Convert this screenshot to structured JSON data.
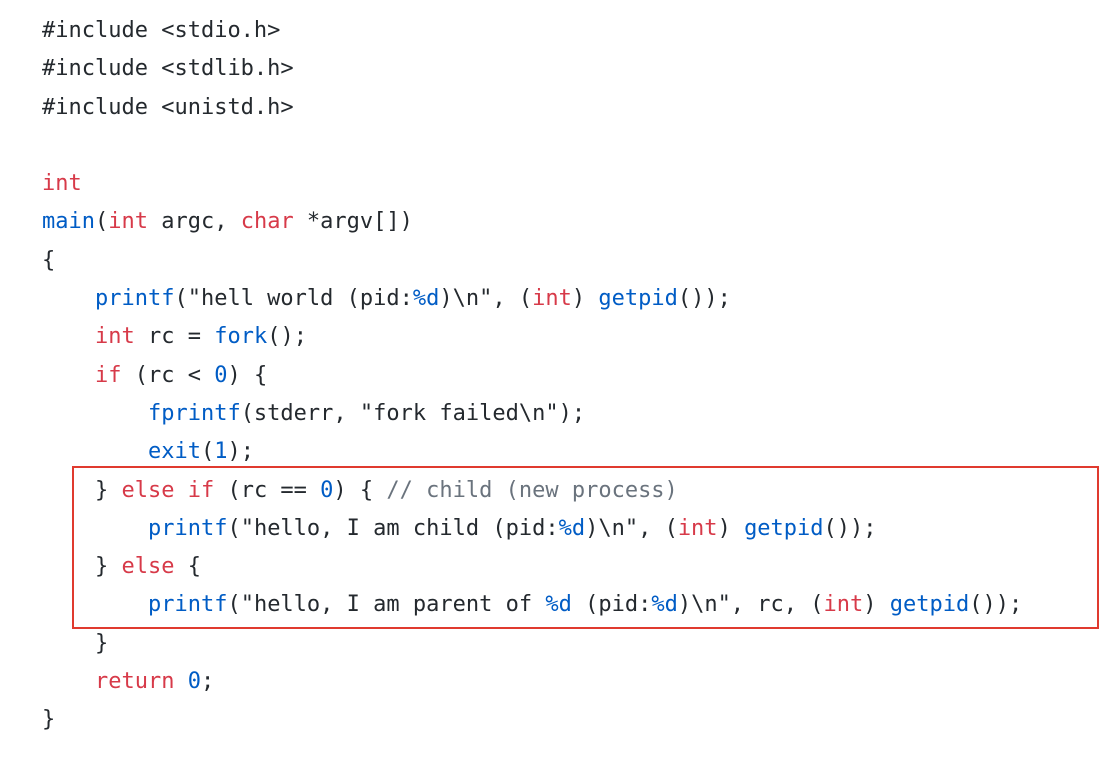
{
  "code": {
    "l1": {
      "a": "#include",
      "b": " <stdio.h>"
    },
    "l2": {
      "a": "#include",
      "b": " <stdlib.h>"
    },
    "l3": {
      "a": "#include",
      "b": " <unistd.h>"
    },
    "l5": {
      "a": "int"
    },
    "l6": {
      "a": "main",
      "b": "(",
      "c": "int",
      "d": " argc, ",
      "e": "char",
      "f": " *argv[])"
    },
    "l7": {
      "a": "{"
    },
    "l8": {
      "a": "printf",
      "b": "(\"hell world (pid:",
      "c": "%d",
      "d": ")\\n\", (",
      "e": "int",
      "f": ") ",
      "g": "getpid",
      "h": "());"
    },
    "l9": {
      "a": "int",
      "b": " rc = ",
      "c": "fork",
      "d": "();"
    },
    "l10": {
      "a": "if",
      "b": " (rc < ",
      "c": "0",
      "d": ") {"
    },
    "l11": {
      "a": "fprintf",
      "b": "(stderr, \"fork failed\\n\");"
    },
    "l12": {
      "a": "exit",
      "b": "(",
      "c": "1",
      "d": ");"
    },
    "l13": {
      "a": "} ",
      "b": "else if",
      "c": " (rc == ",
      "d": "0",
      "e": ") { ",
      "f": "// child (new process)"
    },
    "l14": {
      "a": "printf",
      "b": "(\"hello, I am child (pid:",
      "c": "%d",
      "d": ")\\n\", (",
      "e": "int",
      "f": ") ",
      "g": "getpid",
      "h": "());"
    },
    "l15": {
      "a": "} ",
      "b": "else",
      "c": " {"
    },
    "l16": {
      "a": "printf",
      "b": "(\"hello, I am parent of ",
      "c": "%d",
      "d": " (pid:",
      "e": "%d",
      "f": ")\\n\", rc, (",
      "g": "int",
      "h": ") ",
      "i": "getpid",
      "j": "());"
    },
    "l17": {
      "a": "}"
    },
    "l18": {
      "a": "return",
      "b": " ",
      "c": "0",
      "d": ";"
    },
    "l19": {
      "a": "}"
    }
  },
  "colors": {
    "keyword": "#d73a49",
    "function": "#005cc5",
    "comment": "#6a737d",
    "text": "#24292e",
    "highlight_border": "#e03a2f"
  }
}
